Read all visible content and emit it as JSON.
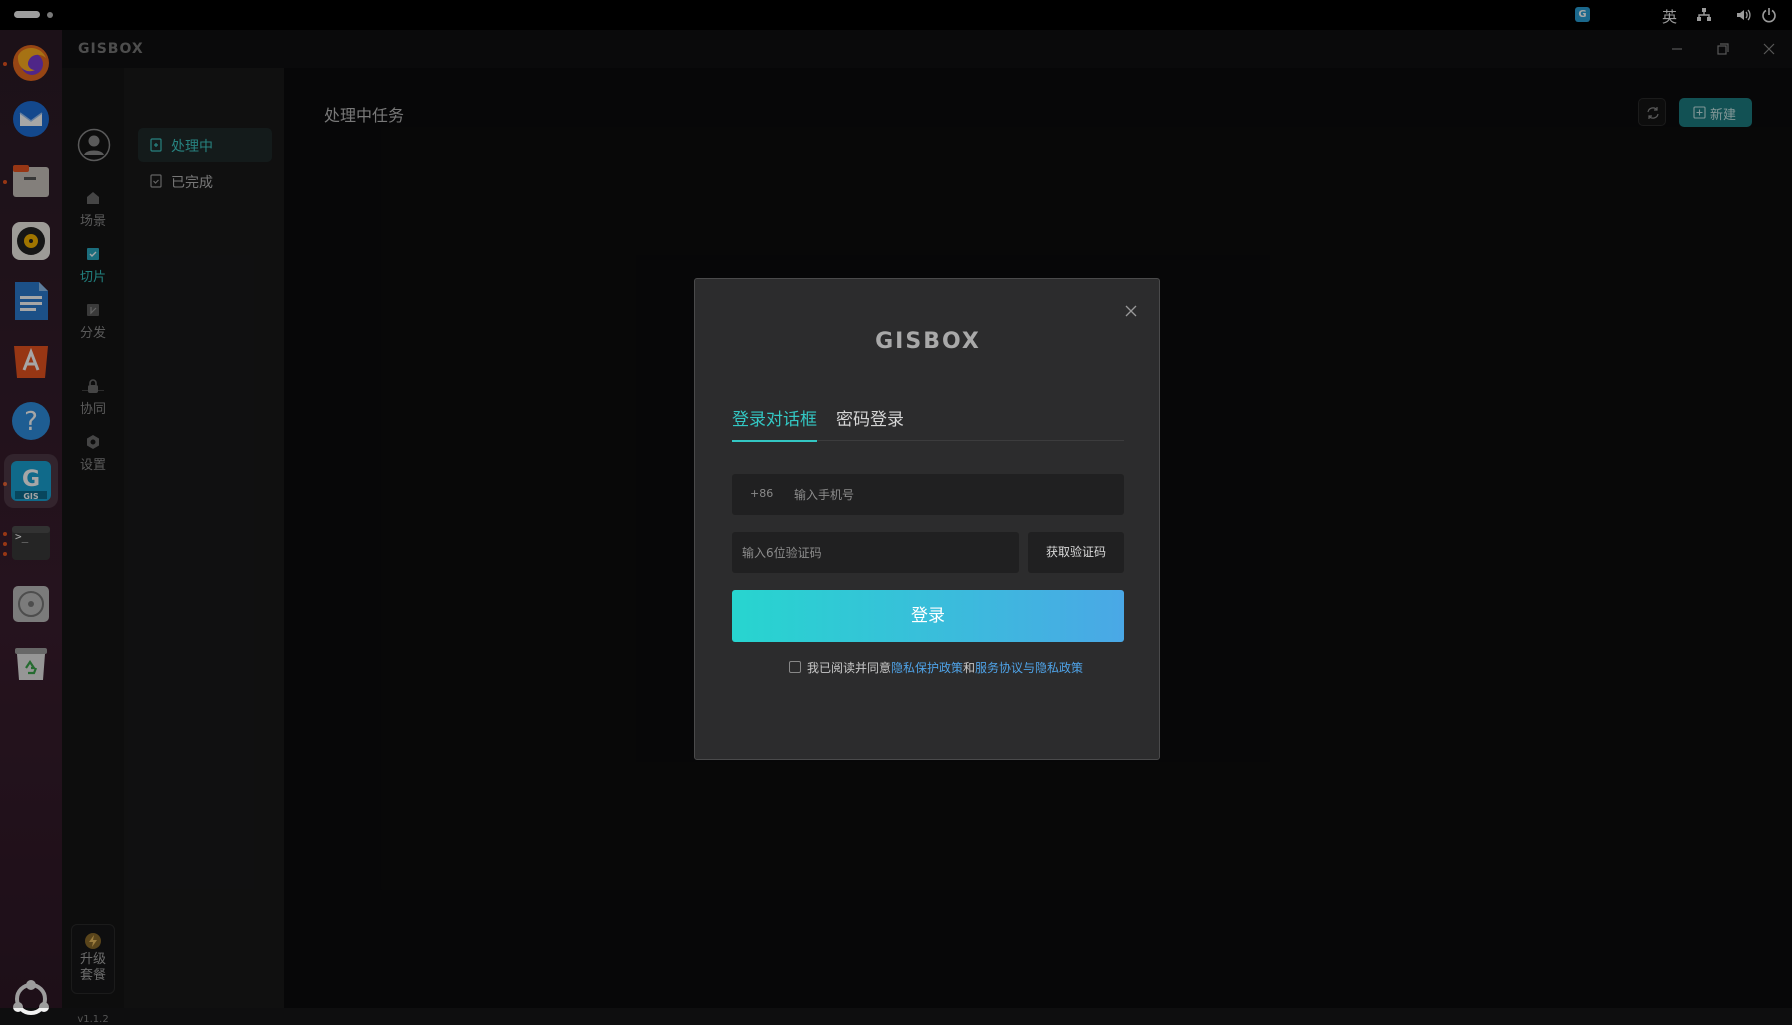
{
  "topbar": {
    "tray_app_letter": "G",
    "input_lang": "英",
    "icons": [
      "network-icon",
      "volume-icon",
      "power-icon"
    ]
  },
  "dock": {
    "items": [
      "firefox",
      "thunderbird",
      "files",
      "rhythmbox",
      "libreoffice-writer",
      "app-center",
      "help",
      "gisbox",
      "terminal",
      "disc",
      "trash"
    ],
    "gisbox_sublabel": "GIS",
    "terminal_prompt": ">_"
  },
  "app": {
    "logo": "GISBOX",
    "rail": {
      "items": [
        {
          "label": "场景",
          "icon": "scene-icon"
        },
        {
          "label": "切片",
          "icon": "tile-icon"
        },
        {
          "label": "分发",
          "icon": "distribute-icon"
        },
        {
          "label": "协同",
          "icon": "collab-icon"
        },
        {
          "label": "设置",
          "icon": "settings-icon"
        }
      ],
      "upgrade_line1": "升级",
      "upgrade_line2": "套餐",
      "version": "v1.1.2"
    },
    "side": {
      "items": [
        {
          "label": "处理中",
          "selected": true
        },
        {
          "label": "已完成",
          "selected": false
        }
      ]
    },
    "content_title": "处理中任务",
    "new_button": "新建"
  },
  "modal": {
    "logo": "GISBOX",
    "tabs": [
      "登录对话框",
      "密码登录"
    ],
    "phone_prefix": "+86",
    "phone_placeholder": "输入手机号",
    "code_placeholder": "输入6位验证码",
    "get_code": "获取验证码",
    "login": "登录",
    "agree_prefix": "我已阅读并同意",
    "privacy_link": "隐私保护政策",
    "and": "和",
    "service_link": "服务协议与隐私政策"
  },
  "colors": {
    "accent": "#33c7c3",
    "login_gradient_start": "#27d5cf",
    "login_gradient_end": "#4aa8e6",
    "link": "#4fa3e8"
  }
}
